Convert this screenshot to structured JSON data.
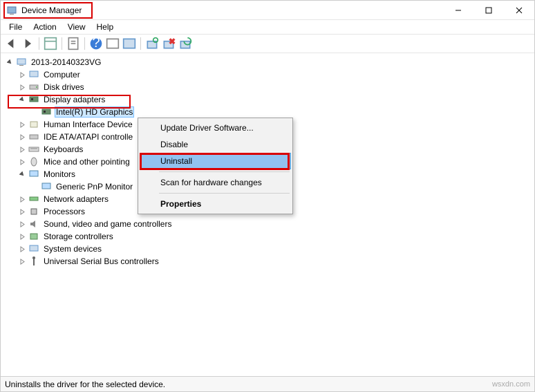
{
  "window": {
    "title": "Device Manager"
  },
  "menu": {
    "file": "File",
    "action": "Action",
    "view": "View",
    "help": "Help"
  },
  "tree": {
    "root": "2013-20140323VG",
    "computer": "Computer",
    "disk": "Disk drives",
    "display": "Display adapters",
    "display_child": "Intel(R) HD Graphics",
    "hid": "Human Interface Device",
    "ide": "IDE ATA/ATAPI controlle",
    "keyboards": "Keyboards",
    "mice": "Mice and other pointing",
    "monitors": "Monitors",
    "monitor_child": "Generic PnP Monitor",
    "network": "Network adapters",
    "processors": "Processors",
    "sound": "Sound, video and game controllers",
    "storage": "Storage controllers",
    "system": "System devices",
    "usb": "Universal Serial Bus controllers"
  },
  "context_menu": {
    "update": "Update Driver Software...",
    "disable": "Disable",
    "uninstall": "Uninstall",
    "scan": "Scan for hardware changes",
    "properties": "Properties"
  },
  "status": "Uninstalls the driver for the selected device.",
  "watermark": "wsxdn.com"
}
